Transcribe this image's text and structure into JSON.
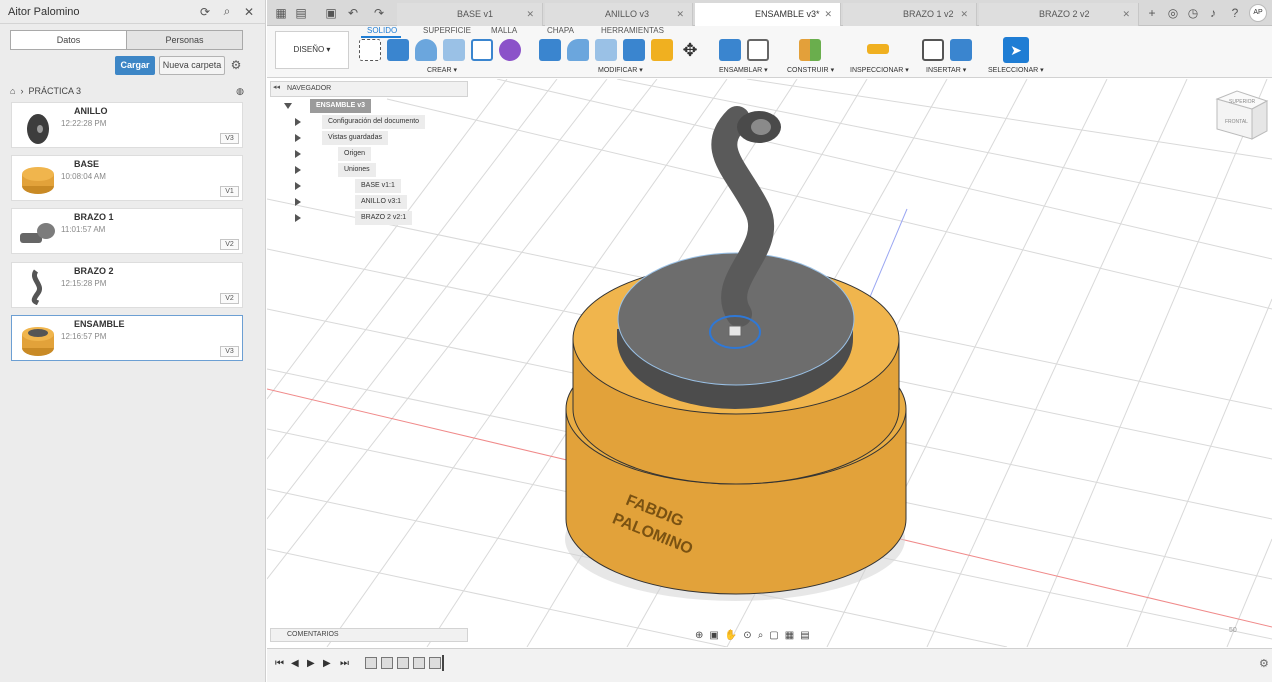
{
  "left_panel": {
    "user_name": "Aitor Palomino",
    "tabs": [
      "Datos",
      "Personas"
    ],
    "upload_label": "Cargar",
    "new_folder_label": "Nueva carpeta",
    "breadcrumb": "PRÁCTICA 3",
    "files": [
      {
        "name": "ANILLO",
        "time": "12:22:28 PM",
        "version": "V3"
      },
      {
        "name": "BASE",
        "time": "10:08:04 AM",
        "version": "V1"
      },
      {
        "name": "BRAZO 1",
        "time": "11:01:57 AM",
        "version": "V2"
      },
      {
        "name": "BRAZO 2",
        "time": "12:15:28 PM",
        "version": "V2"
      },
      {
        "name": "ENSAMBLE",
        "time": "12:16:57 PM",
        "version": "V3"
      }
    ]
  },
  "doc_tabs": [
    "BASE v1",
    "ANILLO v3",
    "ENSAMBLE v3*",
    "BRAZO 1 v2",
    "BRAZO 2 v2"
  ],
  "user_initials": "AP",
  "ribbon": {
    "workspace": "DISEÑO",
    "tabs": [
      "SOLIDO",
      "SUPERFICIE",
      "MALLA",
      "CHAPA",
      "HERRAMIENTAS"
    ],
    "groups": [
      "CREAR",
      "MODIFICAR",
      "ENSAMBLAR",
      "CONSTRUIR",
      "INSPECCIONAR",
      "INSERTAR",
      "SELECCIONAR"
    ]
  },
  "browser": {
    "title": "NAVEGADOR",
    "root": "ENSAMBLE v3",
    "items": [
      "Configuración del documento",
      "Vistas guardadas",
      "Origen",
      "Uniones",
      "BASE v1:1",
      "ANILLO v3:1",
      "BRAZO 2 v2:1"
    ]
  },
  "comments_label": "COMENTARIOS",
  "model_text": [
    "FABDIG",
    "PALOMINO"
  ],
  "viewcube": {
    "top": "SUPERIOR",
    "front": "FRONTAL"
  },
  "axis_label": "50",
  "colors": {
    "accent": "#1f7dd4",
    "base": "#e2a23a",
    "metal": "#5d5d5d",
    "grid": "#d6d6d6"
  }
}
